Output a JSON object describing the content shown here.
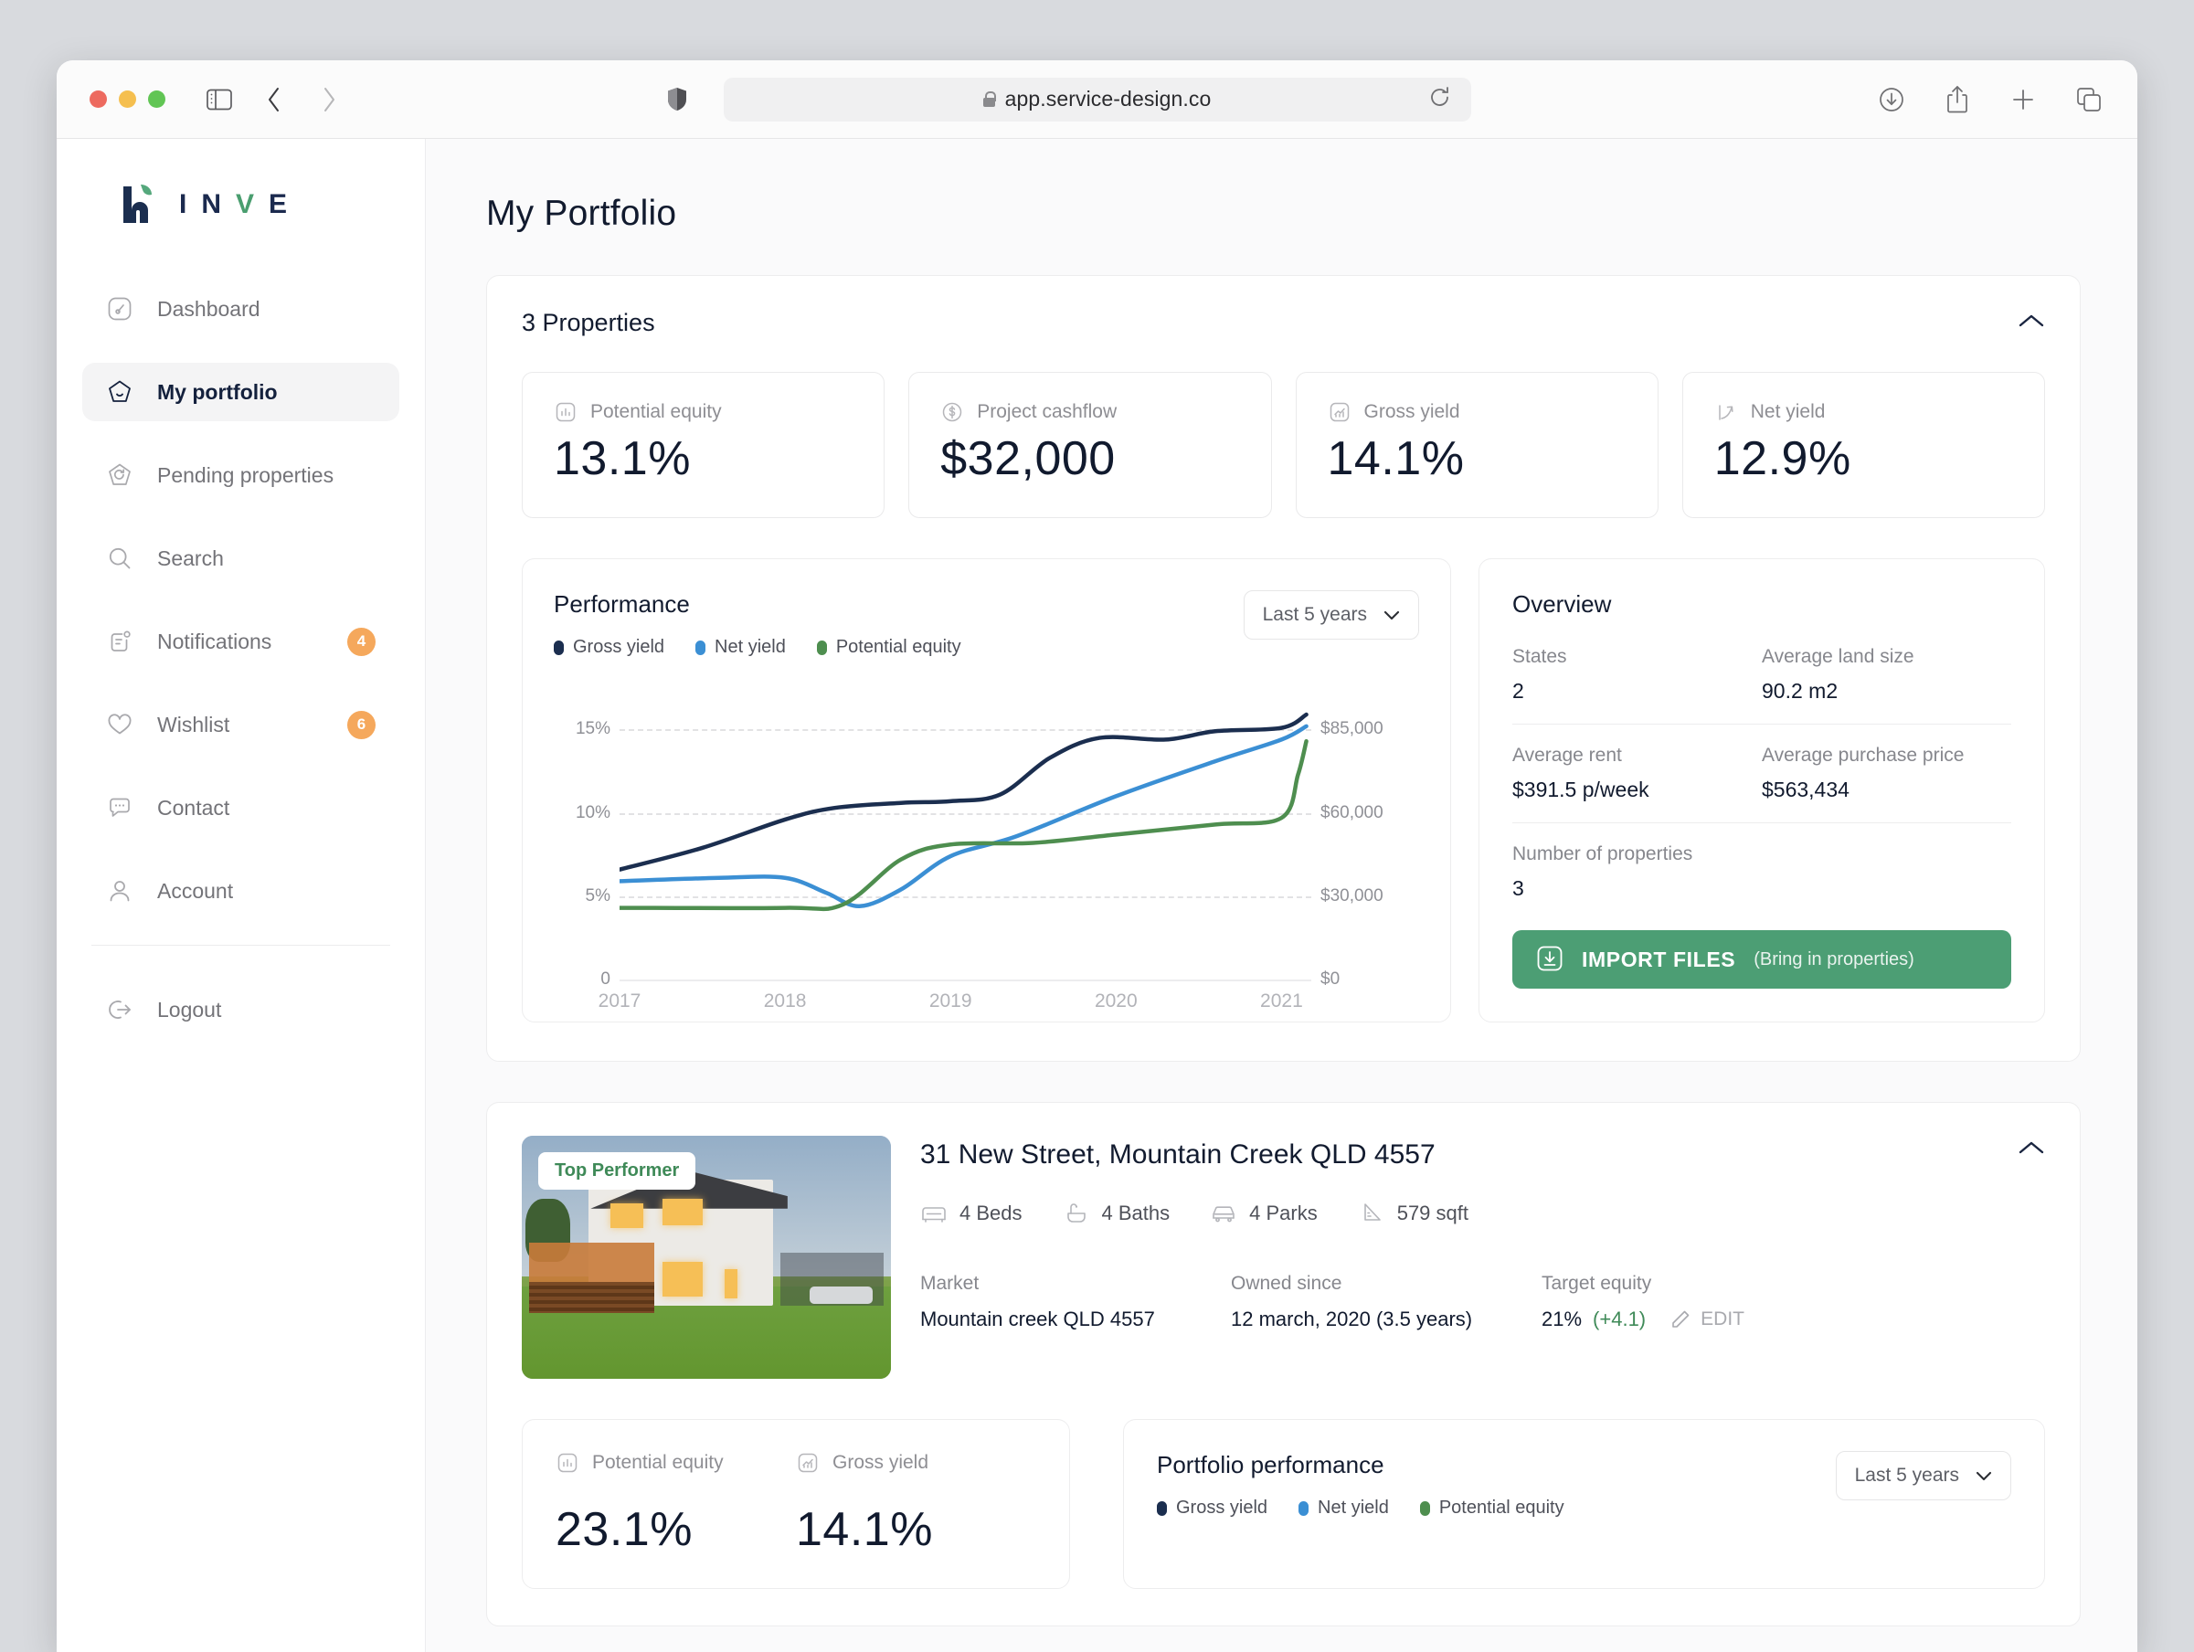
{
  "browser": {
    "url": "app.service-design.co",
    "lock_icon": "lock-icon",
    "reload_icon": "reload-icon",
    "sidebar_toggle_icon": "sidebar-toggle-icon",
    "back_icon": "back-chevron-icon",
    "forward_icon": "forward-chevron-icon",
    "shield_icon": "shield-icon",
    "downloads_icon": "downloads-icon",
    "share_icon": "share-icon",
    "new_tab_icon": "plus-icon",
    "tabs_icon": "tab-overview-icon"
  },
  "sidebar": {
    "logo_text": [
      "I",
      "N",
      "V",
      "E"
    ],
    "items": [
      {
        "label": "Dashboard",
        "icon": "dashboard-icon",
        "badge": null,
        "active": false
      },
      {
        "label": "My portfolio",
        "icon": "home-pentagon-icon",
        "badge": null,
        "active": true
      },
      {
        "label": "Pending properties",
        "icon": "pending-refresh-icon",
        "badge": null,
        "active": false
      },
      {
        "label": "Search",
        "icon": "search-icon",
        "badge": null,
        "active": false
      },
      {
        "label": "Notifications",
        "icon": "notification-icon",
        "badge": "4",
        "active": false
      },
      {
        "label": "Wishlist",
        "icon": "heart-icon",
        "badge": "6",
        "active": false
      },
      {
        "label": "Contact",
        "icon": "chat-icon",
        "badge": null,
        "active": false
      },
      {
        "label": "Account",
        "icon": "user-icon",
        "badge": null,
        "active": false
      }
    ],
    "logout": {
      "label": "Logout",
      "icon": "logout-icon"
    }
  },
  "page": {
    "title": "My Portfolio"
  },
  "properties_section": {
    "title": "3 Properties",
    "collapse_icon": "chevron-up-icon",
    "kpis": [
      {
        "label": "Potential equity",
        "value": "13.1%",
        "icon": "bar-chart-icon"
      },
      {
        "label": "Project cashflow",
        "value": "$32,000",
        "icon": "dollar-circle-icon"
      },
      {
        "label": "Gross yield",
        "value": "14.1%",
        "icon": "trend-up-icon"
      },
      {
        "label": "Net yield",
        "value": "12.9%",
        "icon": "arrow-growth-icon"
      }
    ]
  },
  "performance": {
    "title": "Performance",
    "range_label": "Last 5 years",
    "range_icon": "chevron-down-icon",
    "legend": [
      {
        "label": "Gross yield",
        "color": "#1b2e4f"
      },
      {
        "label": "Net yield",
        "color": "#3b8fd4"
      },
      {
        "label": "Potential equity",
        "color": "#4e8e4f"
      }
    ]
  },
  "chart_data": {
    "type": "line",
    "title": "Performance",
    "xlabel": "",
    "ylabel": "",
    "grid": true,
    "legend_position": "top-left",
    "x": [
      2017,
      2018,
      2019,
      2020,
      2021
    ],
    "xtick_labels": [
      "2017",
      "2018",
      "2019",
      "2020",
      "2021"
    ],
    "y_left_ticks": [
      "0",
      "5%",
      "10%",
      "15%"
    ],
    "y_left_values": [
      0,
      5,
      10,
      15
    ],
    "y_right_ticks": [
      "$0",
      "$30,000",
      "$60,000",
      "$85,000"
    ],
    "y_right_values": [
      0,
      30000,
      60000,
      85000
    ],
    "ylim": [
      0,
      17
    ],
    "series": [
      {
        "name": "Gross yield",
        "color": "#1b2e4f",
        "axis": "left",
        "points": [
          [
            2017,
            6.6
          ],
          [
            2017.5,
            7.9
          ],
          [
            2018,
            9.6
          ],
          [
            2018.3,
            10.3
          ],
          [
            2018.7,
            10.6
          ],
          [
            2019,
            10.7
          ],
          [
            2019.3,
            11.1
          ],
          [
            2019.6,
            13.3
          ],
          [
            2019.9,
            14.5
          ],
          [
            2020.3,
            14.4
          ],
          [
            2020.6,
            14.9
          ],
          [
            2021,
            15.1
          ],
          [
            2021.15,
            15.9
          ]
        ]
      },
      {
        "name": "Net yield",
        "color": "#3b8fd4",
        "axis": "left",
        "points": [
          [
            2017,
            5.9
          ],
          [
            2017.6,
            6.1
          ],
          [
            2018,
            6.1
          ],
          [
            2018.25,
            5.2
          ],
          [
            2018.45,
            4.4
          ],
          [
            2018.7,
            5.4
          ],
          [
            2019,
            7.4
          ],
          [
            2019.4,
            8.6
          ],
          [
            2020,
            11.0
          ],
          [
            2020.6,
            13.1
          ],
          [
            2021,
            14.4
          ],
          [
            2021.15,
            15.2
          ]
        ]
      },
      {
        "name": "Potential equity",
        "color": "#4e8e4f",
        "axis": "right",
        "points": [
          [
            2017,
            4.3
          ],
          [
            2018,
            4.3
          ],
          [
            2018.35,
            4.5
          ],
          [
            2018.7,
            7.2
          ],
          [
            2019,
            8.1
          ],
          [
            2019.5,
            8.2
          ],
          [
            2020,
            8.7
          ],
          [
            2020.6,
            9.3
          ],
          [
            2021,
            9.7
          ],
          [
            2021.1,
            12.3
          ],
          [
            2021.15,
            14.3
          ]
        ]
      }
    ]
  },
  "overview": {
    "title": "Overview",
    "cells": [
      {
        "key": "States",
        "value": "2"
      },
      {
        "key": "Average land size",
        "value": "90.2 m2"
      },
      {
        "key": "Average rent",
        "value": "$391.5 p/week"
      },
      {
        "key": "Average purchase price",
        "value": "$563,434"
      },
      {
        "key": "Number of properties",
        "value": "3"
      }
    ],
    "import_button": {
      "primary": "IMPORT FILES",
      "secondary": "(Bring in properties)",
      "icon": "download-box-icon",
      "color": "#4c9e74"
    }
  },
  "property": {
    "badge": "Top Performer",
    "address": "31 New Street, Mountain Creek QLD 4557",
    "collapse_icon": "chevron-up-icon",
    "features": [
      {
        "label": "4 Beds",
        "icon": "bed-icon"
      },
      {
        "label": "4 Baths",
        "icon": "bath-icon"
      },
      {
        "label": "4 Parks",
        "icon": "car-icon"
      },
      {
        "label": "579 sqft",
        "icon": "area-icon"
      }
    ],
    "meta": [
      {
        "key": "Market",
        "value": "Mountain creek QLD 4557"
      },
      {
        "key": "Owned since",
        "value": "12 march, 2020 (3.5 years)"
      }
    ],
    "target_equity": {
      "key": "Target equity",
      "value": "21%",
      "delta": "(+4.1)",
      "edit_label": "EDIT",
      "edit_icon": "pencil-icon"
    },
    "bottom_kpis": [
      {
        "label": "Potential equity",
        "value": "23.1%",
        "icon": "bar-chart-icon"
      },
      {
        "label": "Gross yield",
        "value": "14.1%",
        "icon": "trend-up-icon"
      }
    ],
    "portfolio_performance": {
      "title": "Portfolio performance",
      "range_label": "Last 5 years",
      "range_icon": "chevron-down-icon",
      "legend": [
        {
          "label": "Gross yield",
          "color": "#1b2e4f"
        },
        {
          "label": "Net yield",
          "color": "#3b8fd4"
        },
        {
          "label": "Potential equity",
          "color": "#4e8e4f"
        }
      ]
    }
  }
}
